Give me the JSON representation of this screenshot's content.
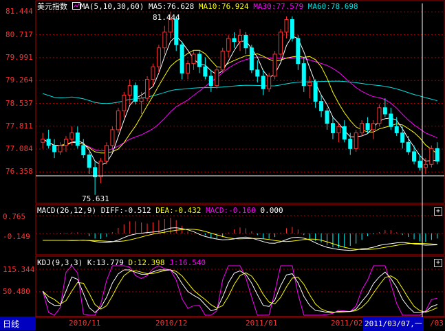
{
  "title": "美元指数",
  "ma_header": {
    "icon": "chart-indicator-icon",
    "params": "MA(5,10,30,60)",
    "ma5": "MA5:76.628",
    "ma10": "MA10:76.924",
    "ma30": "MA30:77.579",
    "ma60": "MA60:78.698"
  },
  "price_axis": [
    "81.444",
    "80.717",
    "79.991",
    "79.264",
    "78.537",
    "77.811",
    "77.084",
    "76.358"
  ],
  "high_label": "81.444",
  "low_label": "75.631",
  "macd_header": {
    "params": "MACD(26,12,9)",
    "diff": "DIFF:-0.512",
    "dea": "DEA:-0.432",
    "macd": "MACD:-0.160",
    "zero": "0.000"
  },
  "macd_axis": [
    "0.765",
    "-0.149"
  ],
  "kdj_header": {
    "params": "KDJ(9,3,3)",
    "k": "K:13.779",
    "d": "D:12.398",
    "j": "J:16.540"
  },
  "kdj_axis": [
    "115.344",
    "50.480"
  ],
  "period_label": "日线",
  "date_labels": [
    "2010/11",
    "2010/12",
    "2011/01",
    "2011/02"
  ],
  "cursor_date": "2011/03/07,一",
  "cursor_trail": "/03",
  "expand_icon": "+",
  "colors": {
    "up": "#ff3232",
    "down": "#00ffff",
    "ma5": "#ffffff",
    "ma10": "#ffff00",
    "ma30": "#ff00ff",
    "ma60": "#00e0e0",
    "grid": "#b00000",
    "axis_text": "#ff3232",
    "cursor_bg": "#0000c0"
  },
  "chart_data": [
    {
      "type": "candlestick",
      "title": "美元指数",
      "ylim": [
        75.631,
        81.444
      ],
      "y_ticks": [
        81.444,
        80.717,
        79.991,
        79.264,
        78.537,
        77.811,
        77.084,
        76.358
      ],
      "x_ticks": [
        "2010/11",
        "2010/12",
        "2011/01",
        "2011/02"
      ],
      "ohlc": [
        [
          77.3,
          77.6,
          77.1,
          77.4
        ],
        [
          77.4,
          77.7,
          77.1,
          77.2
        ],
        [
          77.2,
          77.4,
          76.8,
          77.0
        ],
        [
          77.0,
          77.3,
          76.9,
          77.2
        ],
        [
          77.2,
          77.5,
          77.0,
          77.4
        ],
        [
          77.4,
          77.8,
          77.2,
          77.6
        ],
        [
          77.6,
          77.8,
          77.1,
          77.2
        ],
        [
          77.2,
          77.4,
          76.8,
          76.9
        ],
        [
          76.9,
          77.0,
          76.3,
          76.5
        ],
        [
          76.5,
          76.7,
          75.631,
          76.2
        ],
        [
          76.2,
          76.8,
          76.0,
          76.7
        ],
        [
          76.7,
          77.3,
          76.6,
          77.2
        ],
        [
          77.2,
          77.8,
          77.0,
          77.7
        ],
        [
          77.7,
          78.4,
          77.6,
          78.3
        ],
        [
          78.3,
          78.9,
          78.1,
          78.8
        ],
        [
          78.8,
          79.3,
          78.5,
          79.1
        ],
        [
          79.1,
          79.2,
          78.5,
          78.6
        ],
        [
          78.6,
          78.9,
          78.2,
          78.7
        ],
        [
          78.7,
          79.4,
          78.6,
          79.3
        ],
        [
          79.3,
          79.8,
          79.1,
          79.7
        ],
        [
          79.7,
          80.4,
          79.5,
          80.3
        ],
        [
          80.3,
          81.0,
          80.1,
          80.8
        ],
        [
          80.8,
          81.444,
          80.6,
          81.2
        ],
        [
          81.2,
          81.3,
          80.2,
          80.4
        ],
        [
          80.4,
          80.5,
          79.3,
          79.5
        ],
        [
          79.5,
          79.9,
          79.3,
          79.8
        ],
        [
          79.8,
          80.2,
          79.6,
          80.1
        ],
        [
          80.1,
          80.2,
          79.5,
          79.7
        ],
        [
          79.7,
          80.0,
          79.3,
          79.4
        ],
        [
          79.4,
          79.6,
          78.9,
          79.1
        ],
        [
          79.1,
          79.7,
          79.0,
          79.6
        ],
        [
          79.6,
          80.3,
          79.5,
          80.2
        ],
        [
          80.2,
          80.7,
          80.0,
          80.6
        ],
        [
          80.6,
          80.8,
          80.3,
          80.5
        ],
        [
          80.5,
          80.9,
          80.2,
          80.7
        ],
        [
          80.7,
          80.8,
          80.1,
          80.3
        ],
        [
          80.3,
          80.4,
          79.5,
          79.6
        ],
        [
          79.6,
          79.9,
          79.2,
          79.4
        ],
        [
          79.4,
          79.6,
          78.8,
          79.0
        ],
        [
          79.0,
          79.5,
          78.9,
          79.4
        ],
        [
          79.4,
          80.2,
          79.3,
          80.1
        ],
        [
          80.1,
          80.9,
          80.0,
          80.8
        ],
        [
          80.8,
          81.3,
          80.6,
          81.2
        ],
        [
          81.2,
          81.3,
          80.5,
          80.6
        ],
        [
          80.6,
          80.7,
          79.6,
          79.8
        ],
        [
          79.8,
          80.0,
          78.9,
          79.1
        ],
        [
          79.1,
          79.4,
          78.7,
          79.2
        ],
        [
          79.2,
          79.3,
          78.4,
          78.6
        ],
        [
          78.6,
          78.8,
          78.1,
          78.3
        ],
        [
          78.3,
          78.4,
          77.7,
          77.9
        ],
        [
          77.9,
          78.1,
          77.4,
          77.6
        ],
        [
          77.6,
          77.9,
          77.3,
          77.8
        ],
        [
          77.8,
          78.0,
          77.3,
          77.4
        ],
        [
          77.4,
          77.6,
          76.9,
          77.1
        ],
        [
          77.1,
          77.7,
          77.0,
          77.6
        ],
        [
          77.6,
          78.0,
          77.5,
          77.9
        ],
        [
          77.9,
          78.1,
          77.6,
          77.7
        ],
        [
          77.7,
          78.0,
          77.4,
          77.9
        ],
        [
          77.9,
          78.5,
          77.8,
          78.4
        ],
        [
          78.4,
          78.7,
          78.1,
          78.2
        ],
        [
          78.2,
          78.4,
          77.7,
          77.8
        ],
        [
          77.8,
          78.1,
          77.5,
          77.6
        ],
        [
          77.6,
          77.8,
          77.1,
          77.3
        ],
        [
          77.3,
          77.5,
          76.9,
          77.0
        ],
        [
          77.0,
          77.2,
          76.6,
          76.7
        ],
        [
          76.7,
          76.9,
          76.4,
          76.5
        ],
        [
          76.5,
          76.8,
          76.3,
          76.6
        ],
        [
          76.6,
          77.2,
          76.5,
          77.1
        ],
        [
          77.1,
          77.3,
          76.6,
          76.7
        ]
      ],
      "ma5_last": 76.628,
      "ma10_last": 76.924,
      "ma30_last": 77.579,
      "ma60_last": 78.698
    },
    {
      "type": "bar",
      "title": "MACD(26,12,9)",
      "ylim": [
        -0.149,
        0.765
      ],
      "diff": -0.512,
      "dea": -0.432,
      "macd": -0.16
    },
    {
      "type": "line",
      "title": "KDJ(9,3,3)",
      "ylim": [
        50.48,
        115.344
      ],
      "k": 13.779,
      "d": 12.398,
      "j": 16.54
    }
  ]
}
